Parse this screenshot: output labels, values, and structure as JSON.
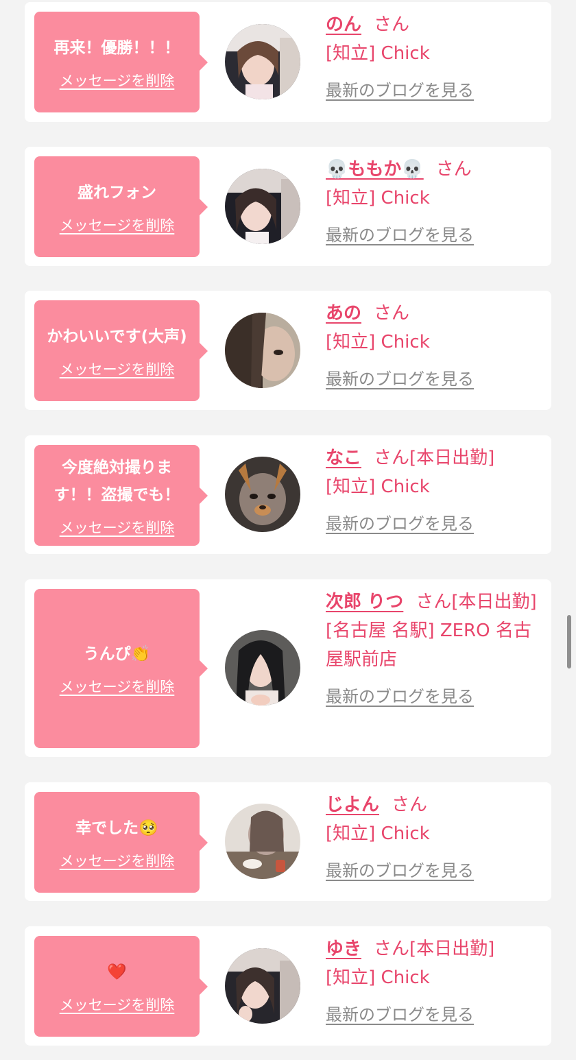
{
  "delete_label": "メッセージを削除",
  "blog_label": "最新のブログを見る",
  "colors": {
    "page_bg": "#f3f3f3",
    "bubble_pink": "#fb8c9e",
    "name_red": "#e8456b",
    "link_gray": "#8a8a8a"
  },
  "items": [
    {
      "message": "再来！優勝！！！",
      "name": "のん",
      "suffix": "さん",
      "shop": "[知立] Chick",
      "avatar_icon": "avatar-photo"
    },
    {
      "message": "盛れフォン",
      "name": "💀ももか💀",
      "suffix": "さん",
      "shop": "[知立] Chick",
      "avatar_icon": "avatar-photo"
    },
    {
      "message": "かわいいです(大声)",
      "name": "あの",
      "suffix": "さん",
      "shop": "[知立] Chick",
      "avatar_icon": "avatar-photo"
    },
    {
      "message": "今度絶対撮ります！！盗撮でも！",
      "name": "なこ",
      "suffix": "さん[本日出勤]",
      "shop": "[知立] Chick",
      "avatar_icon": "avatar-photo"
    },
    {
      "message": "うんぴ👏",
      "name": "次郎 りつ",
      "suffix": "さん[本日出勤]",
      "shop": "[名古屋 名駅] ZERO 名古屋駅前店",
      "avatar_icon": "avatar-photo"
    },
    {
      "message": "幸でした🥺",
      "name": "じよん",
      "suffix": "さん",
      "shop": "[知立] Chick",
      "avatar_icon": "avatar-photo"
    },
    {
      "message": "❤️",
      "name": "ゆき",
      "suffix": "さん[本日出勤]",
      "shop": "[知立] Chick",
      "avatar_icon": "avatar-photo"
    }
  ]
}
